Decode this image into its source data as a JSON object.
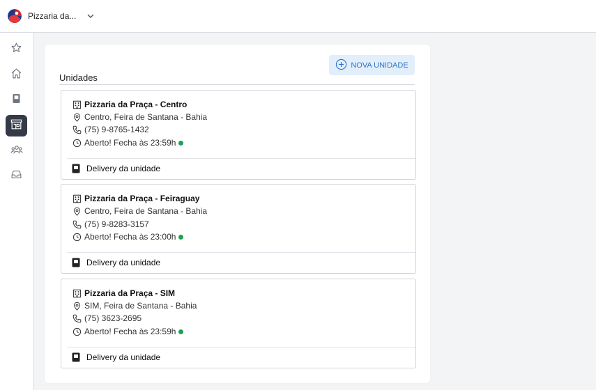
{
  "header": {
    "store_name": "Pizzaria da..."
  },
  "sidebar": {
    "items": [
      {
        "name": "favoritos",
        "icon": "star-icon"
      },
      {
        "name": "inicio",
        "icon": "home-icon"
      },
      {
        "name": "cardapio",
        "icon": "menu-book-icon"
      },
      {
        "name": "unidades",
        "icon": "storefront-icon",
        "active": true
      },
      {
        "name": "clientes",
        "icon": "people-icon"
      },
      {
        "name": "pedidos",
        "icon": "inbox-icon"
      }
    ]
  },
  "panel": {
    "title": "Unidades",
    "new_button_label": "NOVA UNIDADE",
    "units": [
      {
        "name": "Pizzaria da Praça - Centro",
        "address": "Centro, Feira de Santana - Bahia",
        "phone": "(75) 9-8765-1432",
        "status": "Aberto! Fecha às 23:59h",
        "delivery_label": "Delivery da unidade"
      },
      {
        "name": "Pizzaria da Praça - Feiraguay",
        "address": "Centro, Feira de Santana - Bahia",
        "phone": "(75) 9-8283-3157",
        "status": "Aberto! Fecha às 23:00h",
        "delivery_label": "Delivery da unidade"
      },
      {
        "name": "Pizzaria da Praça - SIM",
        "address": "SIM, Feira de Santana - Bahia",
        "phone": "(75) 3623-2695",
        "status": "Aberto! Fecha às 23:59h",
        "delivery_label": "Delivery da unidade"
      }
    ]
  },
  "colors": {
    "accent": "#2f73c7",
    "accent_bg": "#e2effb",
    "sidebar_active": "#343a46",
    "status_open": "#1aa252"
  }
}
